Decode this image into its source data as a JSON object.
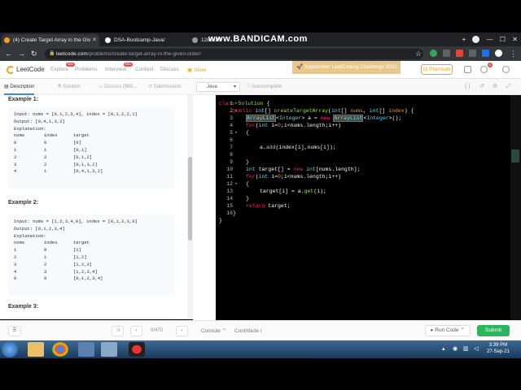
{
  "browser": {
    "tabs": [
      {
        "title": "(4) Create Target Array in the Giv"
      },
      {
        "title": "DSA-Bootcamp-Java/"
      },
      {
        "title": "1280x80"
      }
    ],
    "recorder_watermark": "www.BANDICAM.com",
    "url_host": "leetcode.com",
    "url_path": "/problems/create-target-array-in-the-given-order/"
  },
  "lc_header": {
    "logo": "LeetCode",
    "nav": [
      {
        "label": "Explore",
        "badge": "New"
      },
      {
        "label": "Problems",
        "badge": ""
      },
      {
        "label": "Interview",
        "badge": "New"
      },
      {
        "label": "Contest",
        "badge": ""
      },
      {
        "label": "Discuss",
        "badge": ""
      },
      {
        "label": "Store",
        "badge": ""
      }
    ],
    "challenge": "September LeetCoding Challenge 2021",
    "premium": "Premium",
    "notif_count": "6"
  },
  "left_tabs": [
    "Description",
    "Solution",
    "Discuss (999...",
    "Submissions"
  ],
  "examples": [
    {
      "heading": "Example 1:",
      "input": "Input: nums = [0,1,2,3,4], index = [0,1,2,2,1]",
      "output": "Output: [0,4,1,3,2]",
      "explanation": "Explanation:",
      "table_header": [
        "nums",
        "index",
        "target"
      ],
      "rows": [
        [
          "0",
          "0",
          "[0]"
        ],
        [
          "1",
          "1",
          "[0,1]"
        ],
        [
          "2",
          "2",
          "[0,1,2]"
        ],
        [
          "3",
          "2",
          "[0,1,3,2]"
        ],
        [
          "4",
          "1",
          "[0,4,1,3,2]"
        ]
      ]
    },
    {
      "heading": "Example 2:",
      "input": "Input: nums = [1,2,3,4,0], index = [0,1,2,3,0]",
      "output": "Output: [0,1,2,3,4]",
      "explanation": "Explanation:",
      "table_header": [
        "nums",
        "index",
        "target"
      ],
      "rows": [
        [
          "1",
          "0",
          "[1]"
        ],
        [
          "2",
          "1",
          "[1,2]"
        ],
        [
          "3",
          "2",
          "[1,2,3]"
        ],
        [
          "4",
          "3",
          "[1,2,3,4]"
        ],
        [
          "0",
          "0",
          "[0,1,2,3,4]"
        ]
      ]
    }
  ],
  "example3_heading": "Example 3:",
  "editor": {
    "language": "Java",
    "autocomplete": "Autocomplete",
    "line_numbers": [
      "1",
      "2",
      "3",
      "4",
      "5",
      "6",
      "7",
      "8",
      "9",
      "10",
      "11",
      "12",
      "13",
      "14",
      "15",
      "16"
    ]
  },
  "bottom": {
    "page_counter": "0/470",
    "console": "Console",
    "contribute": "Contribute",
    "run_code": "Run Code",
    "submit": "Submit"
  },
  "taskbar": {
    "time": "3:39 PM",
    "date": "27-Sep-21"
  }
}
